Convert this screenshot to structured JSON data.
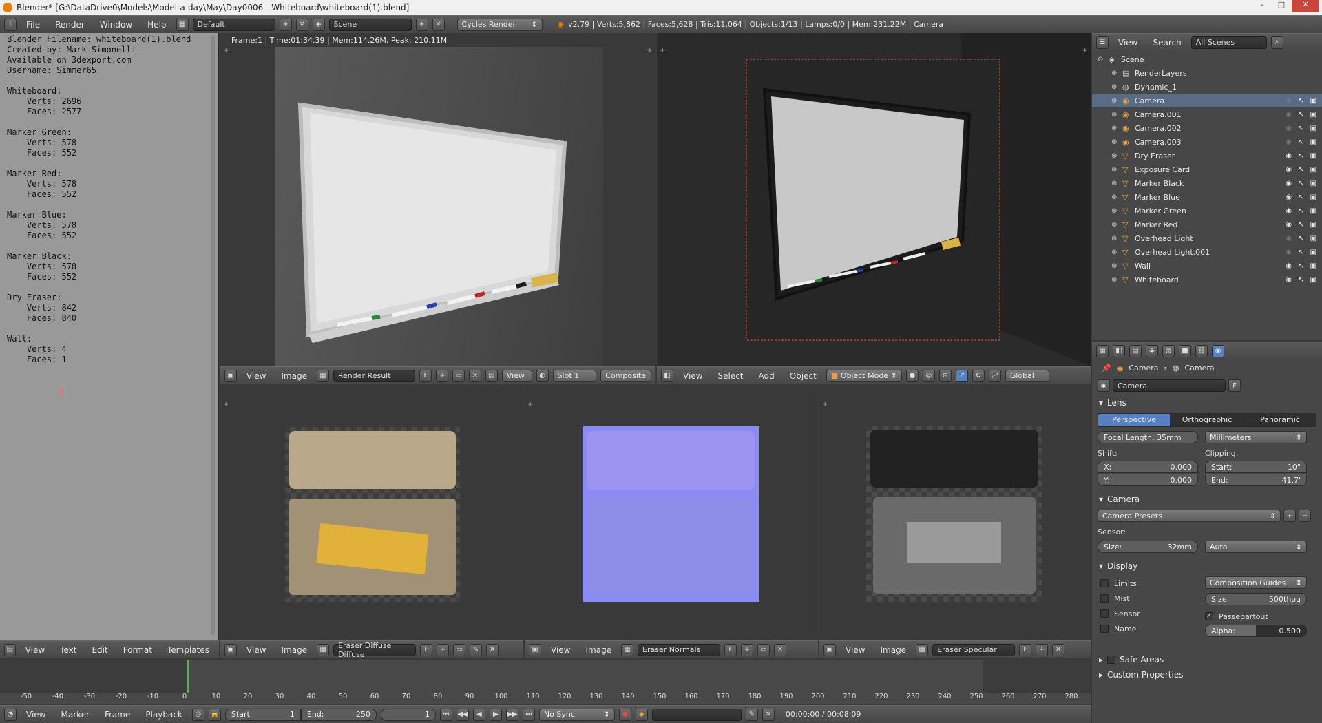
{
  "window": {
    "title": "Blender* [G:\\DataDrive0\\Models\\Model-a-day\\May\\Day0006 - Whiteboard\\whiteboard(1).blend]",
    "controls": [
      "–",
      "□",
      "✕"
    ]
  },
  "topbar": {
    "menus": [
      "File",
      "Render",
      "Window",
      "Help"
    ],
    "layout": "Default",
    "scene": "Scene",
    "engine": "Cycles Render",
    "stats": "v2.79 | Verts:5,862 | Faces:5,628 | Tris:11,064 | Objects:1/13 | Lamps:0/0 | Mem:231.22M | Camera"
  },
  "text_editor": {
    "lines": [
      "Blender Filename: whiteboard(1).blend",
      "Created by: Mark Simonelli",
      "Available on 3dexport.com",
      "Username: Simmer65",
      "",
      "Whiteboard:",
      "    Verts: 2696",
      "    Faces: 2577",
      "",
      "Marker Green:",
      "    Verts: 578",
      "    Faces: 552",
      "",
      "Marker Red:",
      "    Verts: 578",
      "    Faces: 552",
      "",
      "Marker Blue:",
      "    Verts: 578",
      "    Faces: 552",
      "",
      "Marker Black:",
      "    Verts: 578",
      "    Faces: 552",
      "",
      "Dry Eraser:",
      "    Verts: 842",
      "    Faces: 840",
      "",
      "Wall:",
      "    Verts: 4",
      "    Faces: 1"
    ],
    "header_menus": [
      "View",
      "Text",
      "Edit",
      "Format",
      "Templates"
    ]
  },
  "render_viewport": {
    "info": "Frame:1 | Time:01:34.39 | Mem:114.26M, Peak: 210.11M",
    "header": {
      "menus": [
        "View",
        "Image"
      ],
      "image": "Render Result",
      "f": "F",
      "view": "View",
      "slot": "Slot 1",
      "pass": "Composite"
    }
  },
  "view3d": {
    "header": {
      "menus": [
        "View",
        "Select",
        "Add",
        "Object"
      ],
      "mode": "Object Mode",
      "orientation": "Global"
    }
  },
  "image_editors": [
    {
      "menus": [
        "View",
        "Image"
      ],
      "image": "Eraser Diffuse Diffuse",
      "f": "F"
    },
    {
      "menus": [
        "View",
        "Image"
      ],
      "image": "Eraser Normals",
      "f": "F"
    },
    {
      "menus": [
        "View",
        "Image"
      ],
      "image": "Eraser Specular",
      "f": "F"
    }
  ],
  "outliner": {
    "header": {
      "view": "View",
      "search": "Search",
      "filter": "All Scenes"
    },
    "items": [
      {
        "name": "Scene",
        "icon": "scene-icon",
        "level": 0,
        "visible": null
      },
      {
        "name": "RenderLayers",
        "icon": "renderlayers-icon",
        "level": 1,
        "visible": null
      },
      {
        "name": "Dynamic_1",
        "icon": "world-icon",
        "level": 1,
        "visible": null
      },
      {
        "name": "Camera",
        "icon": "camera-icon",
        "level": 1,
        "visible": false,
        "selected": true
      },
      {
        "name": "Camera.001",
        "icon": "camera-icon",
        "level": 1,
        "visible": false
      },
      {
        "name": "Camera.002",
        "icon": "camera-icon",
        "level": 1,
        "visible": false
      },
      {
        "name": "Camera.003",
        "icon": "camera-icon",
        "level": 1,
        "visible": false
      },
      {
        "name": "Dry Eraser",
        "icon": "mesh-icon",
        "level": 1,
        "visible": true
      },
      {
        "name": "Exposure Card",
        "icon": "mesh-icon",
        "level": 1,
        "visible": true
      },
      {
        "name": "Marker Black",
        "icon": "mesh-icon",
        "level": 1,
        "visible": true
      },
      {
        "name": "Marker Blue",
        "icon": "mesh-icon",
        "level": 1,
        "visible": true
      },
      {
        "name": "Marker Green",
        "icon": "mesh-icon",
        "level": 1,
        "visible": true
      },
      {
        "name": "Marker Red",
        "icon": "mesh-icon",
        "level": 1,
        "visible": true
      },
      {
        "name": "Overhead Light",
        "icon": "mesh-icon",
        "level": 1,
        "visible": false
      },
      {
        "name": "Overhead Light.001",
        "icon": "mesh-icon",
        "level": 1,
        "visible": false
      },
      {
        "name": "Wall",
        "icon": "mesh-icon",
        "level": 1,
        "visible": true
      },
      {
        "name": "Whiteboard",
        "icon": "mesh-icon",
        "level": 1,
        "visible": true
      }
    ]
  },
  "properties": {
    "breadcrumb": [
      "Camera",
      "Camera"
    ],
    "datablock": "Camera",
    "datablock_f": "F",
    "lens": {
      "title": "Lens",
      "tabs": [
        "Perspective",
        "Orthographic",
        "Panoramic"
      ],
      "active_tab": 0,
      "focal_length": "Focal Length:   35mm",
      "units": "Millimeters",
      "shift_label": "Shift:",
      "shift_x": "X:",
      "shift_x_val": "0.000",
      "shift_y": "Y:",
      "shift_y_val": "0.000",
      "clipping_label": "Clipping:",
      "clip_start": "Start:",
      "clip_start_val": "10\"",
      "clip_end": "End:",
      "clip_end_val": "41.7'"
    },
    "camera": {
      "title": "Camera",
      "presets": "Camera Presets",
      "sensor_label": "Sensor:",
      "size": "Size:",
      "size_val": "32mm",
      "fit": "Auto"
    },
    "display": {
      "title": "Display",
      "checks": [
        "Limits",
        "Mist",
        "Sensor",
        "Name"
      ],
      "guides": "Composition Guides",
      "size": "Size:",
      "size_val": "500thou",
      "passepartout": "Passepartout",
      "alpha": "Alpha:",
      "alpha_val": "0.500",
      "alpha_fraction": 0.5
    },
    "safe_areas": "Safe Areas",
    "custom_properties": "Custom Properties"
  },
  "timeline": {
    "ticks": [
      "-50",
      "-40",
      "-30",
      "-20",
      "-10",
      "0",
      "10",
      "20",
      "30",
      "40",
      "50",
      "60",
      "70",
      "80",
      "90",
      "100",
      "110",
      "120",
      "130",
      "140",
      "150",
      "160",
      "170",
      "180",
      "190",
      "200",
      "210",
      "220",
      "230",
      "240",
      "250",
      "260",
      "270",
      "280"
    ],
    "menus": [
      "View",
      "Marker",
      "Frame",
      "Playback"
    ],
    "start": "Start:",
    "start_val": "1",
    "end": "End:",
    "end_val": "250",
    "current": "1",
    "sync": "No Sync",
    "time": "00:00:00 / 00:08:09"
  },
  "colors": {
    "accent": "#5680c2",
    "text_editor_bg": "#999999",
    "timeline_bg": "#484848",
    "dark_panel": "#2b2b2b",
    "selection_border": "#e05a2a"
  }
}
